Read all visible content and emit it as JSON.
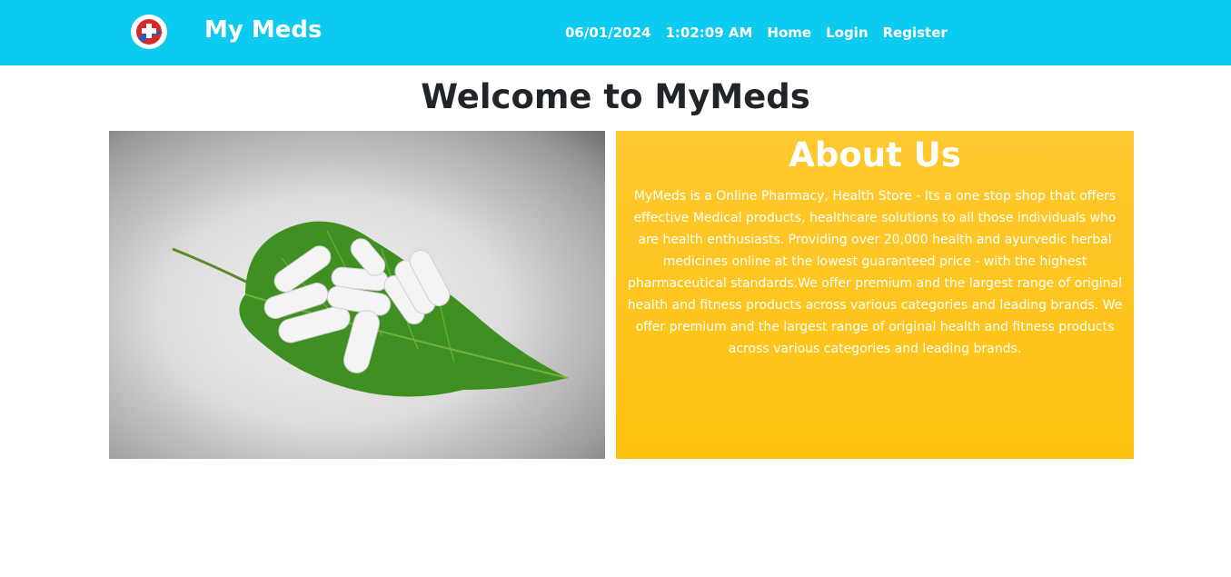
{
  "header": {
    "logo_icon": "pharmacy-cross-icon",
    "brand": "My Meds",
    "date": "06/01/2024",
    "time": "1:02:09 AM",
    "nav": [
      {
        "label": "Home"
      },
      {
        "label": "Login"
      },
      {
        "label": "Register"
      }
    ]
  },
  "main": {
    "heading": "Welcome to MyMeds",
    "about": {
      "title": "About Us",
      "text": "MyMeds is a Online Pharmacy, Health Store - Its a one stop shop that offers effective Medical products, healthcare solutions to all those individuals who are health enthusiasts. Providing over 20,000 health and ayurvedic herbal medicines online at the lowest guaranteed price - with the highest pharmaceutical standards.We offer premium and the largest range of original health and fitness products across various categories and leading brands. We offer premium and the largest range of original health and fitness products across various categories and leading brands."
    }
  },
  "colors": {
    "navbar": "#0dcaf0",
    "about_bg": "#fcc10f",
    "text_dark": "#212529"
  }
}
